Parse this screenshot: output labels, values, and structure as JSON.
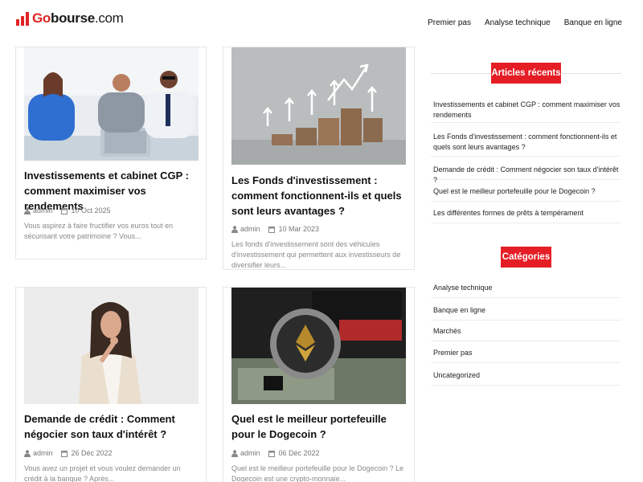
{
  "header": {
    "logo": {
      "part1": "Go",
      "part2": "bourse",
      "part3": ".com"
    },
    "nav": [
      "Premier pas",
      "Analyse technique",
      "Banque en ligne"
    ]
  },
  "posts": [
    {
      "title": "Investissements et cabinet CGP : comment maximiser vos rendements",
      "author": "admin",
      "date": "10 Oct 2025",
      "excerpt": "Vous aspirez à faire fructifier vos euros tout en sécurisant votre patrimoine ? Vous..."
    },
    {
      "title": "Les Fonds d'investissement : comment fonctionnent-ils et quels sont leurs avantages ?",
      "author": "admin",
      "date": "10 Mar 2023",
      "excerpt": "Les fonds d'investissement sont des véhicules d'investissement qui permettent aux investisseurs de diversifier leurs..."
    },
    {
      "title": "Demande de crédit : Comment négocier son taux d'intérêt ?",
      "author": "admin",
      "date": "26 Déc 2022",
      "excerpt": "Vous avez un projet et vous voulez demander un crédit à la banque ? Après..."
    },
    {
      "title": "Quel est le meilleur portefeuille pour le Dogecoin ?",
      "author": "admin",
      "date": "06 Déc 2022",
      "excerpt": "Quel est le meilleur portefeuille pour le Dogecoin ? Le Dogecoin est une crypto-monnaie..."
    }
  ],
  "sidebar": {
    "recent_title": "Articles récents",
    "recent": [
      "Investissements et cabinet CGP : comment maximiser vos rendements",
      "Les Fonds d'investissement : comment fonctionnent-ils et quels sont leurs avantages ?",
      "Demande de crédit : Comment négocier son taux d'intérêt ?",
      "Quel est le meilleur portefeuille pour le Dogecoin ?",
      "Les différentes formes de prêts à tempérament"
    ],
    "categories_title": "Catégories",
    "categories": [
      "Analyse technique",
      "Banque en ligne",
      "Marchés",
      "Premier pas",
      "Uncategorized"
    ]
  },
  "colors": {
    "accent": "#e51e25",
    "logo_red": "#e02424"
  },
  "icons": {
    "author": "user-icon",
    "date": "calendar-icon"
  }
}
